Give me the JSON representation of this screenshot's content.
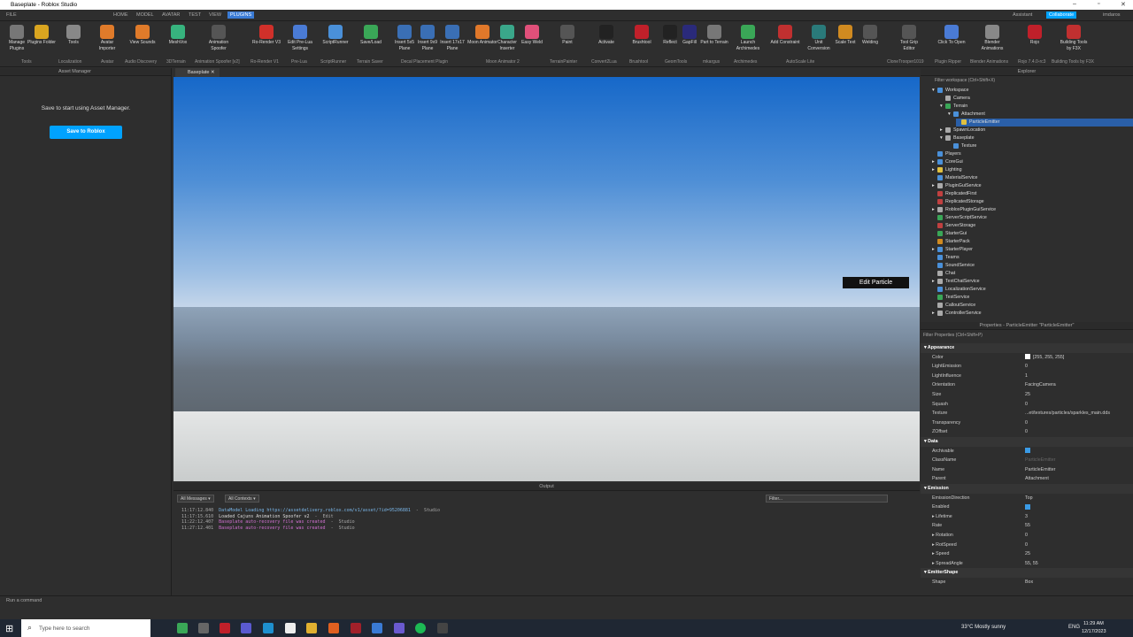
{
  "window": {
    "title": "Baseplate - Roblox Studio"
  },
  "menubar": {
    "items": [
      "FILE",
      "HOME",
      "MODEL",
      "AVATAR",
      "TEST",
      "VIEW",
      "PLUGINS"
    ],
    "assistant": "Assistant",
    "collaborate": "Collaborate",
    "user": "imdaros"
  },
  "ribbon": {
    "buttons": [
      {
        "label": "Manage Plugins",
        "icon": "gear-icon",
        "color": "#777"
      },
      {
        "label": "Plugins Folder",
        "icon": "folder-icon",
        "color": "#d9a520"
      },
      {
        "label": "Tools",
        "icon": "tools-icon",
        "color": "#888"
      },
      {
        "label": "Avatar Importer",
        "icon": "avatar-icon",
        "color": "#e07b2a"
      },
      {
        "label": "View Sounds",
        "icon": "sound-icon",
        "color": "#e07b2a"
      },
      {
        "label": "MeshVox",
        "icon": "meshvox-icon",
        "color": "#37b37e"
      },
      {
        "label": "Animation Spoofer",
        "icon": "spoofer-icon",
        "color": "#555"
      },
      {
        "label": "Ro-Render V3",
        "icon": "rorender-icon",
        "color": "#d0302a"
      },
      {
        "label": "Edit Pre-Lua Settings",
        "icon": "settings-icon",
        "color": "#4a7bd5"
      },
      {
        "label": "ScriptRunner",
        "icon": "script-icon",
        "color": "#4a90d9"
      },
      {
        "label": "Save/Load",
        "icon": "save-icon",
        "color": "#3aa757"
      },
      {
        "label": "Insert 5x5 Plane",
        "icon": "grid-icon",
        "color": "#3a6fb5"
      },
      {
        "label": "Insert 9x9 Plane",
        "icon": "grid-icon",
        "color": "#3a6fb5"
      },
      {
        "label": "Insert 17x17 Plane",
        "icon": "grid-icon",
        "color": "#3a6fb5"
      },
      {
        "label": "Moon Animator",
        "icon": "moon-icon",
        "color": "#e0782a"
      },
      {
        "label": "Character Inserter",
        "icon": "character-icon",
        "color": "#3aa78a"
      },
      {
        "label": "Easy Weld",
        "icon": "weld-icon",
        "color": "#e0507a"
      },
      {
        "label": "Paint",
        "icon": "paint-icon",
        "color": "#555"
      },
      {
        "label": "Activate",
        "icon": "activate-icon",
        "color": "#222"
      },
      {
        "label": "Brushtool",
        "icon": "brush-icon",
        "color": "#c0202a"
      },
      {
        "label": "Reflect",
        "icon": "reflect-icon",
        "color": "#222"
      },
      {
        "label": "GapFill",
        "icon": "gapfill-icon",
        "color": "#2a2a7a"
      },
      {
        "label": "Part to Terrain",
        "icon": "terrain-icon",
        "color": "#777"
      },
      {
        "label": "Launch Archimedes",
        "icon": "archimedes-icon",
        "color": "#3aa757"
      },
      {
        "label": "Add Constraint",
        "icon": "constraint-icon",
        "color": "#c03030"
      },
      {
        "label": "Unit Conversion",
        "icon": "unit-icon",
        "color": "#2a7a7a"
      },
      {
        "label": "Scale Text",
        "icon": "text-icon",
        "color": "#d08a20"
      },
      {
        "label": "Welding",
        "icon": "welding-icon",
        "color": "#555"
      },
      {
        "label": "Tool Grip Editor",
        "icon": "grip-icon",
        "color": "#555"
      },
      {
        "label": "Click To Open",
        "icon": "clickopen-icon",
        "color": "#4a7bd5"
      },
      {
        "label": "Blender Animations",
        "icon": "blender-icon",
        "color": "#888"
      },
      {
        "label": "Rojo",
        "icon": "rojo-icon",
        "color": "#c0202a"
      },
      {
        "label": "Building Tools by F3X",
        "icon": "f3x-icon",
        "color": "#c03030"
      }
    ],
    "groups": [
      "Tools",
      "Localization",
      "Avatar",
      "Audio Discovery",
      "3DTerrain",
      "Animation Spoofer [v2]",
      "Ro-Render V1",
      "Pre-Lua",
      "ScriptRunner",
      "Terrain Saver",
      "Decal Placement Plugin",
      "Moon Animator 2",
      "TerrainPainter",
      "Convert2Lua",
      "Brushtool",
      "GeomTools",
      "mkargus",
      "Archimedes",
      "AutoScale Lite",
      "CloneTrooper1019",
      "Plugin Ripper",
      "Blender Animations",
      "Rojo 7.4.0-rc3",
      "Building Tools by F3X"
    ]
  },
  "asset_manager": {
    "title": "Asset Manager",
    "message": "Save to start using Asset Manager.",
    "button": "Save to Roblox"
  },
  "viewport": {
    "tab": "Baseplate",
    "tooltip": "Edit Particle"
  },
  "output": {
    "title": "Output",
    "filter_messages": "All Messages",
    "filter_contexts": "All Contexts",
    "filter_placeholder": "Filter...",
    "lines": [
      {
        "time": "11:17:12.840",
        "text": "DataModel Loading https://assetdelivery.roblox.com/v1/asset/?id=95206881",
        "src": "  -  Studio",
        "color": "#7ab6e8"
      },
      {
        "time": "11:17:15.610",
        "text": "Loaded Cajuns Animation Spoofer v2",
        "src": "  -  Edit",
        "color": "#ddd"
      },
      {
        "time": "11:22:12.407",
        "text": "Baseplate auto-recovery file was created",
        "src": "  -  Studio",
        "color": "#d070d0"
      },
      {
        "time": "11:27:12.401",
        "text": "Baseplate auto-recovery file was created",
        "src": "  -  Studio",
        "color": "#d070d0"
      }
    ]
  },
  "explorer": {
    "title": "Explorer",
    "filter": "Filter workspace (Ctrl+Shift+X)",
    "items": [
      {
        "label": "Workspace",
        "indent": 1,
        "color": "#4a90d9",
        "exp": "▾"
      },
      {
        "label": "Camera",
        "indent": 2,
        "color": "#aaa",
        "exp": ""
      },
      {
        "label": "Terrain",
        "indent": 2,
        "color": "#3aa757",
        "exp": "▾"
      },
      {
        "label": "Attachment",
        "indent": 3,
        "color": "#4a90d9",
        "exp": "▾"
      },
      {
        "label": "ParticleEmitter",
        "indent": 4,
        "color": "#e0c040",
        "exp": "",
        "sel": true
      },
      {
        "label": "SpawnLocation",
        "indent": 2,
        "color": "#aaa",
        "exp": "▸"
      },
      {
        "label": "Baseplate",
        "indent": 2,
        "color": "#aaa",
        "exp": "▾"
      },
      {
        "label": "Texture",
        "indent": 3,
        "color": "#4a90d9",
        "exp": ""
      },
      {
        "label": "Players",
        "indent": 1,
        "color": "#4a90d9",
        "exp": ""
      },
      {
        "label": "CoreGui",
        "indent": 1,
        "color": "#4a90d9",
        "exp": "▸"
      },
      {
        "label": "Lighting",
        "indent": 1,
        "color": "#e0c040",
        "exp": "▸"
      },
      {
        "label": "MaterialService",
        "indent": 1,
        "color": "#4a90d9",
        "exp": ""
      },
      {
        "label": "PluginGuiService",
        "indent": 1,
        "color": "#aaa",
        "exp": "▸"
      },
      {
        "label": "ReplicatedFirst",
        "indent": 1,
        "color": "#c04040",
        "exp": ""
      },
      {
        "label": "ReplicatedStorage",
        "indent": 1,
        "color": "#c04040",
        "exp": ""
      },
      {
        "label": "RobloxPluginGuiService",
        "indent": 1,
        "color": "#aaa",
        "exp": "▸"
      },
      {
        "label": "ServerScriptService",
        "indent": 1,
        "color": "#3aa757",
        "exp": ""
      },
      {
        "label": "ServerStorage",
        "indent": 1,
        "color": "#c04040",
        "exp": ""
      },
      {
        "label": "StarterGui",
        "indent": 1,
        "color": "#3aa757",
        "exp": ""
      },
      {
        "label": "StarterPack",
        "indent": 1,
        "color": "#d08a20",
        "exp": ""
      },
      {
        "label": "StarterPlayer",
        "indent": 1,
        "color": "#4a90d9",
        "exp": "▸"
      },
      {
        "label": "Teams",
        "indent": 1,
        "color": "#4a90d9",
        "exp": ""
      },
      {
        "label": "SoundService",
        "indent": 1,
        "color": "#4a90d9",
        "exp": ""
      },
      {
        "label": "Chat",
        "indent": 1,
        "color": "#aaa",
        "exp": ""
      },
      {
        "label": "TextChatService",
        "indent": 1,
        "color": "#aaa",
        "exp": "▸"
      },
      {
        "label": "LocalizationService",
        "indent": 1,
        "color": "#4a90d9",
        "exp": ""
      },
      {
        "label": "TestService",
        "indent": 1,
        "color": "#3aa757",
        "exp": ""
      },
      {
        "label": "CalloutService",
        "indent": 1,
        "color": "#aaa",
        "exp": ""
      },
      {
        "label": "ControllerService",
        "indent": 1,
        "color": "#aaa",
        "exp": "▸"
      }
    ]
  },
  "properties": {
    "title": "Properties - ParticleEmitter \"ParticleEmitter\"",
    "filter": "Filter Properties (Ctrl+Shift+P)",
    "rows": [
      {
        "k": "Appearance",
        "cat": true
      },
      {
        "k": "Color",
        "v": "[255, 255, 255]",
        "swatch": true
      },
      {
        "k": "LightEmission",
        "v": "0"
      },
      {
        "k": "LightInfluence",
        "v": "1"
      },
      {
        "k": "Orientation",
        "v": "FacingCamera"
      },
      {
        "k": "Size",
        "v": "25"
      },
      {
        "k": "Squash",
        "v": "0"
      },
      {
        "k": "Texture",
        "v": "...et/textures/particles/sparkles_main.dds"
      },
      {
        "k": "Transparency",
        "v": "0"
      },
      {
        "k": "ZOffset",
        "v": "0"
      },
      {
        "k": "Data",
        "cat": true
      },
      {
        "k": "Archivable",
        "check": true
      },
      {
        "k": "ClassName",
        "v": "ParticleEmitter",
        "dim": true
      },
      {
        "k": "Name",
        "v": "ParticleEmitter"
      },
      {
        "k": "Parent",
        "v": "Attachment"
      },
      {
        "k": "Emission",
        "cat": true
      },
      {
        "k": "EmissionDirection",
        "v": "Top"
      },
      {
        "k": "Enabled",
        "check": true
      },
      {
        "k": "Lifetime",
        "v": "3",
        "exp": true
      },
      {
        "k": "Rate",
        "v": "55"
      },
      {
        "k": "Rotation",
        "v": "0",
        "exp": true
      },
      {
        "k": "RotSpeed",
        "v": "0",
        "exp": true
      },
      {
        "k": "Speed",
        "v": "25",
        "exp": true
      },
      {
        "k": "SpreadAngle",
        "v": "55, 55",
        "exp": true
      },
      {
        "k": "EmitterShape",
        "cat": true
      },
      {
        "k": "Shape",
        "v": "Box"
      }
    ]
  },
  "command_bar": {
    "placeholder": "Run a command"
  },
  "taskbar": {
    "search": "Type here to search",
    "weather": "33°C  Mostly sunny",
    "lang": "ENG",
    "time": "11:29 AM",
    "date": "12/17/2023"
  }
}
